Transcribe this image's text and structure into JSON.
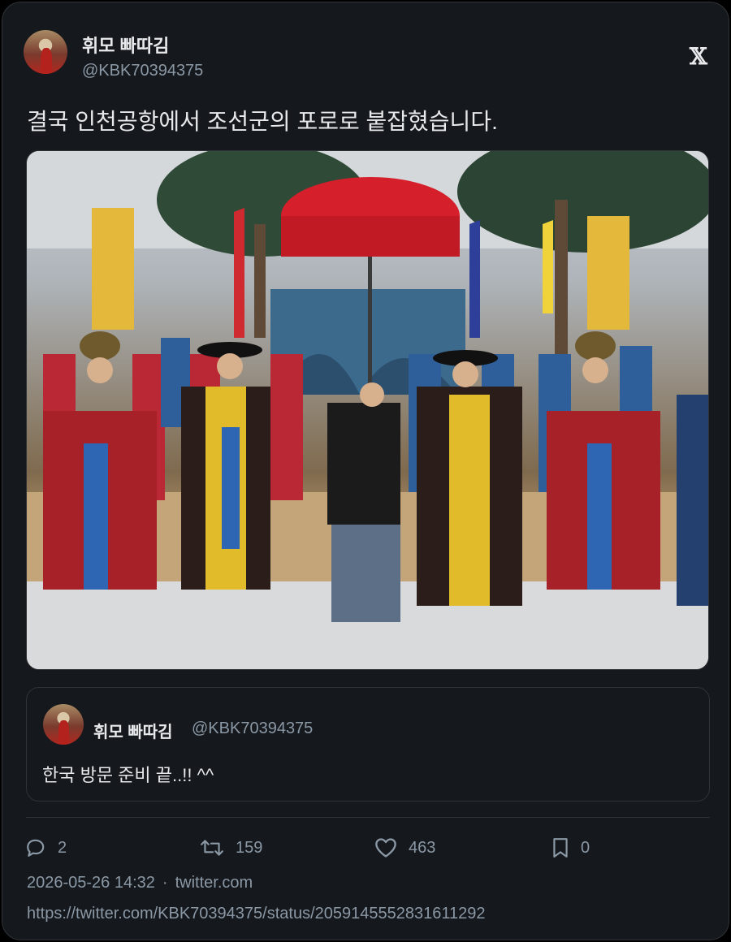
{
  "author": {
    "name": "휘모 빠따김",
    "handle": "@KBK70394375"
  },
  "brand": {
    "logo": "𝕏",
    "icon": "x-logo-icon"
  },
  "tweet": {
    "text": "결국 인천공항에서 조선군의 포로로 붙잡혔습니다."
  },
  "quoted_tweet": {
    "name": "휘모 빠따김",
    "handle": "@KBK70394375",
    "text": "한국 방문 준비 끝..!! ^^"
  },
  "stats": {
    "replies": "2",
    "retweets": "159",
    "likes": "463",
    "bookmarks": "0"
  },
  "meta": {
    "timestamp": "2026-05-26 14:32",
    "separator": "·",
    "source": "twitter.com",
    "url": "https://twitter.com/KBK70394375/status/2059145552831611292"
  },
  "colors": {
    "background": "#15181c",
    "border": "#2f3336",
    "text_primary": "#e7e9ea",
    "text_secondary": "#8b98a5"
  }
}
